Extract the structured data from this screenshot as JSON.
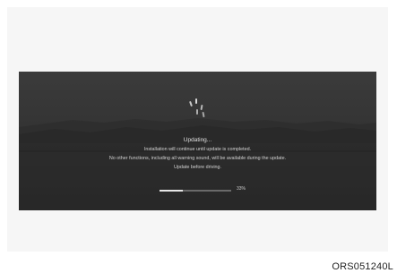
{
  "screen": {
    "title": "Updating...",
    "line1": "Installation will continue until update is completed.",
    "line2": "No other functions, including all warning sound, will be available during the update.",
    "line3": "Update before driving.",
    "progress": {
      "percent": 33,
      "label": "33%"
    }
  },
  "caption": "ORS051240L",
  "icons": {
    "spinner": "loading-spinner-icon"
  },
  "colors": {
    "screen_background": "#333333",
    "text": "#d2d2d2",
    "progress_fill": "#e6e6e6",
    "progress_track": "#6a6a6a"
  }
}
